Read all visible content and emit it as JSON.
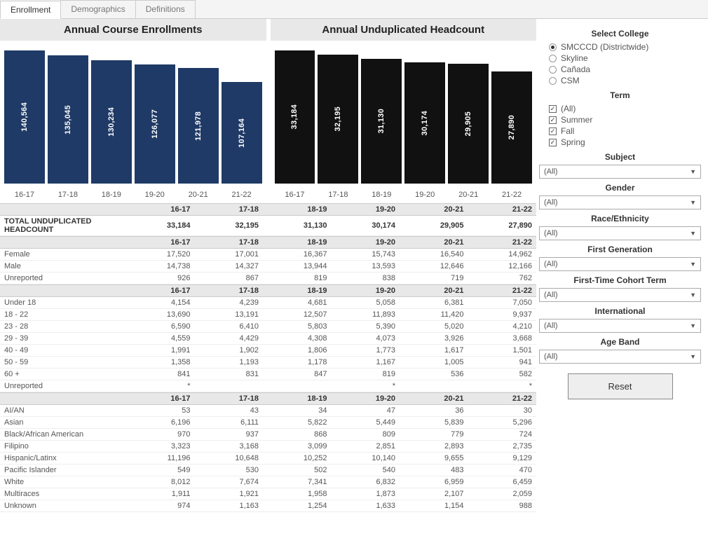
{
  "tabs": [
    "Enrollment",
    "Demographics",
    "Definitions"
  ],
  "active_tab": 0,
  "chart_data": [
    {
      "type": "bar",
      "title": "Annual Course Enrollments",
      "categories": [
        "16-17",
        "17-18",
        "18-19",
        "19-20",
        "20-21",
        "21-22"
      ],
      "values": [
        140564,
        135045,
        130234,
        126077,
        121978,
        107164
      ],
      "value_labels": [
        "140,564",
        "135,045",
        "130,234",
        "126,077",
        "121,978",
        "107,164"
      ],
      "color": "#1f3a66"
    },
    {
      "type": "bar",
      "title": "Annual Unduplicated Headcount",
      "categories": [
        "16-17",
        "17-18",
        "18-19",
        "19-20",
        "20-21",
        "21-22"
      ],
      "values": [
        33184,
        32195,
        31130,
        30174,
        29905,
        27890
      ],
      "value_labels": [
        "33,184",
        "32,195",
        "31,130",
        "30,174",
        "29,905",
        "27,890"
      ],
      "color": "#111111"
    }
  ],
  "tables": [
    {
      "header": [
        "",
        "16-17",
        "17-18",
        "18-19",
        "19-20",
        "20-21",
        "21-22"
      ],
      "rows": [
        {
          "label": "TOTAL UNDUPLICATED HEADCOUNT",
          "bold": true,
          "cells": [
            "33,184",
            "32,195",
            "31,130",
            "30,174",
            "29,905",
            "27,890"
          ]
        }
      ]
    },
    {
      "header": [
        "",
        "16-17",
        "17-18",
        "18-19",
        "19-20",
        "20-21",
        "21-22"
      ],
      "rows": [
        {
          "label": "Female",
          "cells": [
            "17,520",
            "17,001",
            "16,367",
            "15,743",
            "16,540",
            "14,962"
          ]
        },
        {
          "label": "Male",
          "cells": [
            "14,738",
            "14,327",
            "13,944",
            "13,593",
            "12,646",
            "12,166"
          ]
        },
        {
          "label": "Unreported",
          "cells": [
            "926",
            "867",
            "819",
            "838",
            "719",
            "762"
          ]
        }
      ]
    },
    {
      "header": [
        "",
        "16-17",
        "17-18",
        "18-19",
        "19-20",
        "20-21",
        "21-22"
      ],
      "rows": [
        {
          "label": "Under 18",
          "cells": [
            "4,154",
            "4,239",
            "4,681",
            "5,058",
            "6,381",
            "7,050"
          ]
        },
        {
          "label": "18 - 22",
          "cells": [
            "13,690",
            "13,191",
            "12,507",
            "11,893",
            "11,420",
            "9,937"
          ]
        },
        {
          "label": "23 - 28",
          "cells": [
            "6,590",
            "6,410",
            "5,803",
            "5,390",
            "5,020",
            "4,210"
          ]
        },
        {
          "label": "29 - 39",
          "cells": [
            "4,559",
            "4,429",
            "4,308",
            "4,073",
            "3,926",
            "3,668"
          ]
        },
        {
          "label": "40 - 49",
          "cells": [
            "1,991",
            "1,902",
            "1,806",
            "1,773",
            "1,617",
            "1,501"
          ]
        },
        {
          "label": "50 - 59",
          "cells": [
            "1,358",
            "1,193",
            "1,178",
            "1,167",
            "1,005",
            "941"
          ]
        },
        {
          "label": "60 +",
          "cells": [
            "841",
            "831",
            "847",
            "819",
            "536",
            "582"
          ]
        },
        {
          "label": "Unreported",
          "cells": [
            "*",
            "",
            "",
            "*",
            "",
            "*"
          ]
        }
      ]
    },
    {
      "header": [
        "",
        "16-17",
        "17-18",
        "18-19",
        "19-20",
        "20-21",
        "21-22"
      ],
      "rows": [
        {
          "label": "AI/AN",
          "cells": [
            "53",
            "43",
            "34",
            "47",
            "36",
            "30"
          ]
        },
        {
          "label": "Asian",
          "cells": [
            "6,196",
            "6,111",
            "5,822",
            "5,449",
            "5,839",
            "5,296"
          ]
        },
        {
          "label": "Black/African American",
          "cells": [
            "970",
            "937",
            "868",
            "809",
            "779",
            "724"
          ]
        },
        {
          "label": "Filipino",
          "cells": [
            "3,323",
            "3,168",
            "3,099",
            "2,851",
            "2,893",
            "2,735"
          ]
        },
        {
          "label": "Hispanic/Latinx",
          "cells": [
            "11,196",
            "10,648",
            "10,252",
            "10,140",
            "9,655",
            "9,129"
          ]
        },
        {
          "label": "Pacific Islander",
          "cells": [
            "549",
            "530",
            "502",
            "540",
            "483",
            "470"
          ]
        },
        {
          "label": "White",
          "cells": [
            "8,012",
            "7,674",
            "7,341",
            "6,832",
            "6,959",
            "6,459"
          ]
        },
        {
          "label": "Multiraces",
          "cells": [
            "1,911",
            "1,921",
            "1,958",
            "1,873",
            "2,107",
            "2,059"
          ]
        },
        {
          "label": "Unknown",
          "cells": [
            "974",
            "1,163",
            "1,254",
            "1,633",
            "1,154",
            "988"
          ]
        }
      ]
    }
  ],
  "filters": {
    "college": {
      "title": "Select College",
      "options": [
        "SMCCCD (Districtwide)",
        "Skyline",
        "Cañada",
        "CSM"
      ],
      "selected": 0
    },
    "term": {
      "title": "Term",
      "options": [
        "(All)",
        "Summer",
        "Fall",
        "Spring"
      ],
      "checked": [
        true,
        true,
        true,
        true
      ]
    },
    "dropdowns": [
      {
        "title": "Subject",
        "value": "(All)"
      },
      {
        "title": "Gender",
        "value": "(All)"
      },
      {
        "title": "Race/Ethnicity",
        "value": "(All)"
      },
      {
        "title": "First Generation",
        "value": "(All)"
      },
      {
        "title": "First-Time Cohort Term",
        "value": "(All)"
      },
      {
        "title": "International",
        "value": "(All)"
      },
      {
        "title": "Age Band",
        "value": "(All)"
      }
    ],
    "reset_label": "Reset"
  }
}
